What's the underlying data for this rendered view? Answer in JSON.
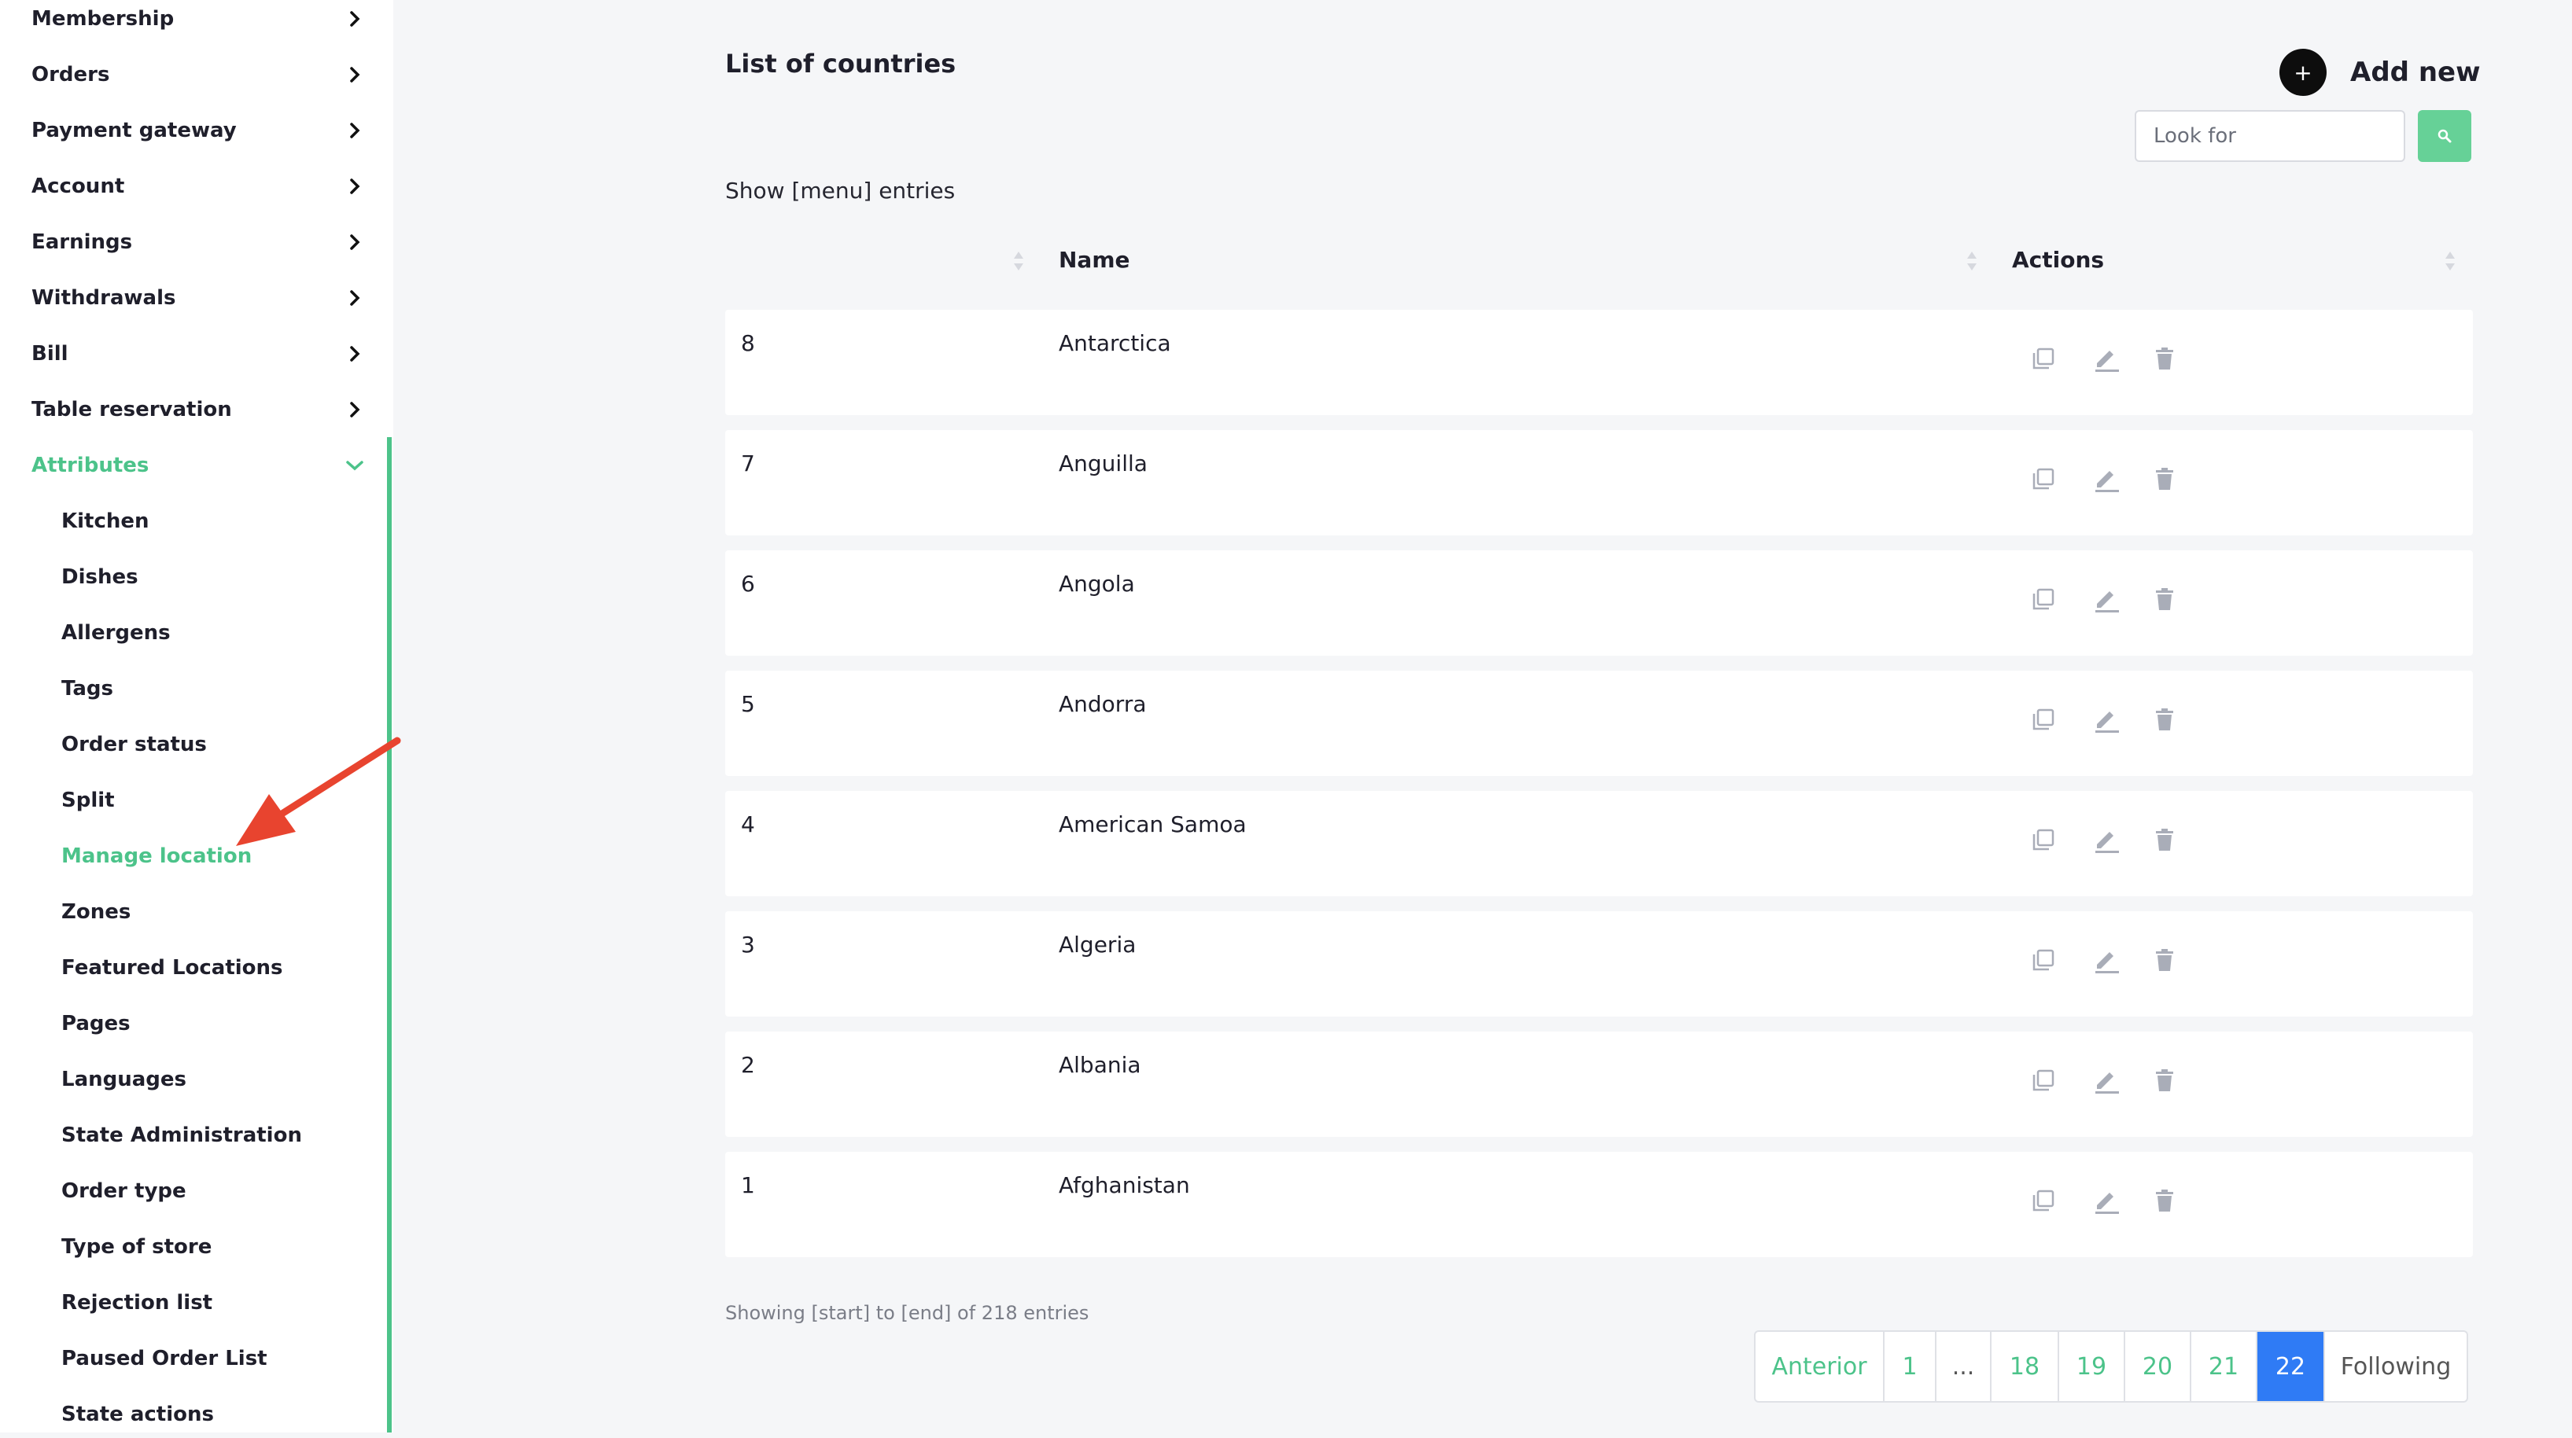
{
  "sidebar": {
    "items": [
      {
        "label": "Membership"
      },
      {
        "label": "Orders"
      },
      {
        "label": "Payment gateway"
      },
      {
        "label": "Account"
      },
      {
        "label": "Earnings"
      },
      {
        "label": "Withdrawals"
      },
      {
        "label": "Bill"
      },
      {
        "label": "Table reservation"
      },
      {
        "label": "Attributes"
      }
    ],
    "sub_items": [
      {
        "label": "Kitchen"
      },
      {
        "label": "Dishes"
      },
      {
        "label": "Allergens"
      },
      {
        "label": "Tags"
      },
      {
        "label": "Order status"
      },
      {
        "label": "Split"
      },
      {
        "label": "Manage location"
      },
      {
        "label": "Zones"
      },
      {
        "label": "Featured Locations"
      },
      {
        "label": "Pages"
      },
      {
        "label": "Languages"
      },
      {
        "label": "State Administration"
      },
      {
        "label": "Order type"
      },
      {
        "label": "Type of store"
      },
      {
        "label": "Rejection list"
      },
      {
        "label": "Paused Order List"
      },
      {
        "label": "State actions"
      }
    ],
    "active_item": "Attributes",
    "active_sub_item": "Manage location"
  },
  "header": {
    "title": "List of countries",
    "add_new": "Add new",
    "add_icon": "+"
  },
  "search": {
    "placeholder": "Look for"
  },
  "entries_text": "Show [menu] entries",
  "table": {
    "columns": [
      "Name",
      "Actions"
    ],
    "rows": [
      {
        "id": "8",
        "name": "Antarctica"
      },
      {
        "id": "7",
        "name": "Anguilla"
      },
      {
        "id": "6",
        "name": "Angola"
      },
      {
        "id": "5",
        "name": "Andorra"
      },
      {
        "id": "4",
        "name": "American Samoa"
      },
      {
        "id": "3",
        "name": "Algeria"
      },
      {
        "id": "2",
        "name": "Albania"
      },
      {
        "id": "1",
        "name": "Afghanistan"
      }
    ]
  },
  "footer": {
    "info": "Showing [start] to [end] of 218 entries"
  },
  "pagination": {
    "prev": "Anterior",
    "pages": [
      "1",
      "...",
      "18",
      "19",
      "20",
      "21",
      "22"
    ],
    "current": "22",
    "next": "Following"
  },
  "colors": {
    "accent": "#4cc38a",
    "active_page": "#2f7bf5",
    "annotation_arrow": "#e8442f"
  }
}
